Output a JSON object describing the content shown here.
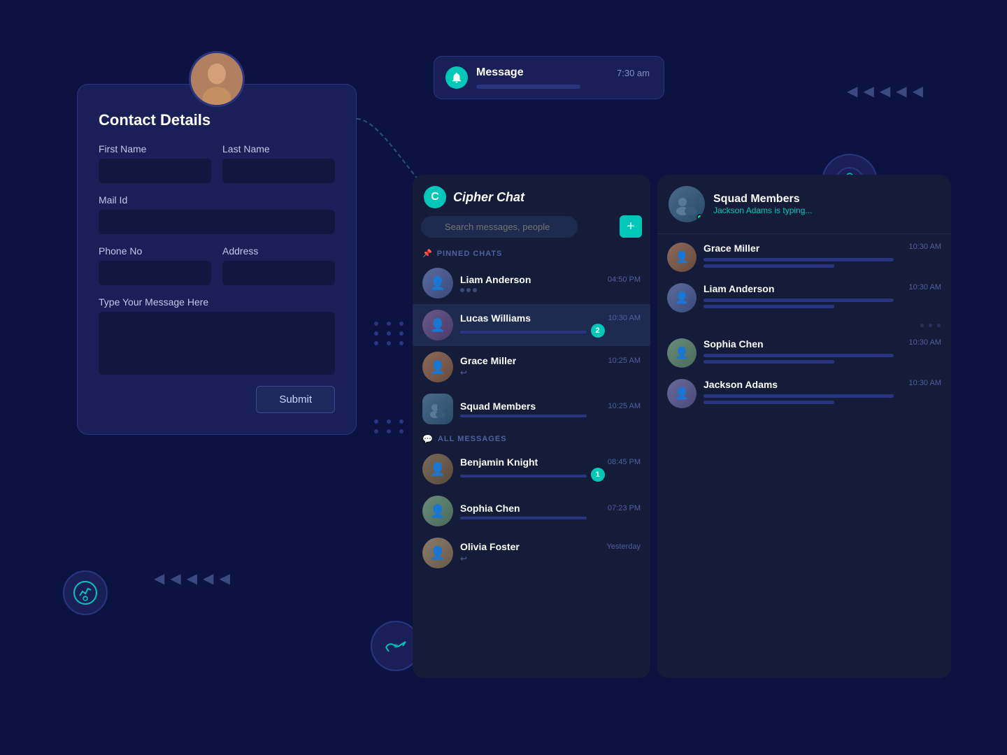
{
  "contact_card": {
    "title": "Contact Details",
    "first_name_label": "First Name",
    "last_name_label": "Last Name",
    "mail_label": "Mail Id",
    "phone_label": "Phone No",
    "address_label": "Address",
    "message_label": "Type Your Message Here",
    "submit_label": "Submit"
  },
  "notification": {
    "title": "Message",
    "time": "7:30 am"
  },
  "chat_app": {
    "logo": "Cipher Chat",
    "search_placeholder": "Search messages, people",
    "add_button": "+",
    "pinned_label": "PINNED CHATS",
    "all_label": "ALL MESSAGES",
    "pinned_chats": [
      {
        "name": "Liam Anderson",
        "time": "04:50 PM",
        "has_dots": true
      },
      {
        "name": "Lucas Williams",
        "time": "10:30 AM",
        "badge": "2"
      },
      {
        "name": "Grace Miller",
        "time": "10:25 AM",
        "has_reply": true
      },
      {
        "name": "Squad Members",
        "time": "10:25 AM"
      }
    ],
    "all_messages": [
      {
        "name": "Benjamin Knight",
        "time": "08:45 PM",
        "badge": "1"
      },
      {
        "name": "Sophia Chen",
        "time": "07:23 PM"
      },
      {
        "name": "Olivia Foster",
        "time": "Yesterday",
        "has_reply": true
      }
    ]
  },
  "right_panel": {
    "header_name": "Squad Members",
    "header_status": "Jackson Adams is typing...",
    "contacts": [
      {
        "name": "Grace Miller",
        "time": "10:30 AM"
      },
      {
        "name": "Liam Anderson",
        "time": "10:30 AM"
      },
      {
        "name": "Sophia Chen",
        "time": "10:30 AM"
      },
      {
        "name": "Jackson Adams",
        "time": "10:30 AM"
      }
    ]
  },
  "nav_arrows_top": [
    "◀",
    "◀",
    "◀",
    "◀",
    "◀"
  ],
  "nav_arrows_bottom": [
    "◀",
    "◀",
    "◀",
    "◀",
    "◀"
  ]
}
